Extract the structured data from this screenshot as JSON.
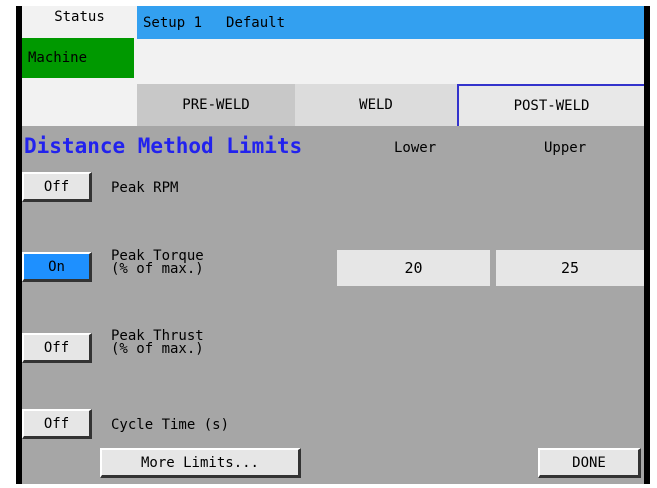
{
  "header": {
    "status_label": "Status",
    "machine_label": "Machine",
    "setup_label": "Setup 1",
    "setup_name": "Default"
  },
  "tabs": [
    {
      "label": "PRE-WELD"
    },
    {
      "label": "WELD"
    },
    {
      "label": "POST-WELD",
      "active": true
    }
  ],
  "page": {
    "title": "Distance Method Limits",
    "lower_header": "Lower",
    "upper_header": "Upper"
  },
  "rows": [
    {
      "toggle": "Off",
      "label1": "Peak RPM",
      "label2": ""
    },
    {
      "toggle": "On",
      "label1": "Peak Torque",
      "label2": "(% of max.)",
      "lower": "20",
      "upper": "25"
    },
    {
      "toggle": "Off",
      "label1": "Peak Thrust",
      "label2": "(% of max.)"
    },
    {
      "toggle": "Off",
      "label1": "Cycle Time (s)",
      "label2": ""
    }
  ],
  "footer": {
    "more_limits": "More Limits...",
    "done": "DONE"
  },
  "colors": {
    "background": "#a6a6a6",
    "accent_blue": "#33a0f0",
    "title_blue": "#2222ee",
    "machine_green": "#009900",
    "toggle_on": "#1e90ff"
  }
}
